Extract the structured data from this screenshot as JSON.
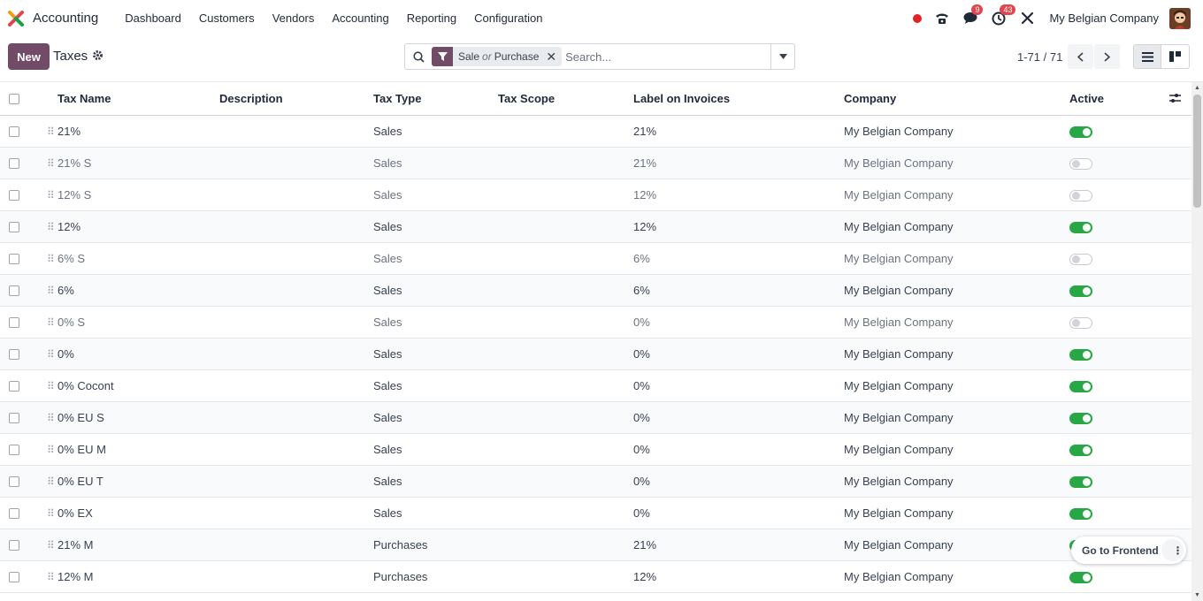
{
  "nav": {
    "app_name": "Accounting",
    "menu": [
      "Dashboard",
      "Customers",
      "Vendors",
      "Accounting",
      "Reporting",
      "Configuration"
    ],
    "messages_count": "9",
    "activities_count": "43",
    "company": "My Belgian Company"
  },
  "control": {
    "new_label": "New",
    "title": "Taxes",
    "facet_left": "Sale",
    "facet_or": "or",
    "facet_right": "Purchase",
    "search_placeholder": "Search...",
    "pager": "1-71 / 71"
  },
  "columns": [
    "Tax Name",
    "Description",
    "Tax Type",
    "Tax Scope",
    "Label on Invoices",
    "Company",
    "Active"
  ],
  "rows": [
    {
      "name": "21%",
      "type": "Sales",
      "label": "21%",
      "company": "My Belgian Company",
      "active": true
    },
    {
      "name": "21% S",
      "type": "Sales",
      "label": "21%",
      "company": "My Belgian Company",
      "active": false
    },
    {
      "name": "12% S",
      "type": "Sales",
      "label": "12%",
      "company": "My Belgian Company",
      "active": false
    },
    {
      "name": "12%",
      "type": "Sales",
      "label": "12%",
      "company": "My Belgian Company",
      "active": true
    },
    {
      "name": "6% S",
      "type": "Sales",
      "label": "6%",
      "company": "My Belgian Company",
      "active": false
    },
    {
      "name": "6%",
      "type": "Sales",
      "label": "6%",
      "company": "My Belgian Company",
      "active": true
    },
    {
      "name": "0% S",
      "type": "Sales",
      "label": "0%",
      "company": "My Belgian Company",
      "active": false
    },
    {
      "name": "0%",
      "type": "Sales",
      "label": "0%",
      "company": "My Belgian Company",
      "active": true
    },
    {
      "name": "0% Cocont",
      "type": "Sales",
      "label": "0%",
      "company": "My Belgian Company",
      "active": true
    },
    {
      "name": "0% EU S",
      "type": "Sales",
      "label": "0%",
      "company": "My Belgian Company",
      "active": true
    },
    {
      "name": "0% EU M",
      "type": "Sales",
      "label": "0%",
      "company": "My Belgian Company",
      "active": true
    },
    {
      "name": "0% EU T",
      "type": "Sales",
      "label": "0%",
      "company": "My Belgian Company",
      "active": true
    },
    {
      "name": "0% EX",
      "type": "Sales",
      "label": "0%",
      "company": "My Belgian Company",
      "active": true
    },
    {
      "name": "21% M",
      "type": "Purchases",
      "label": "21%",
      "company": "My Belgian Company",
      "active": true
    },
    {
      "name": "12% M",
      "type": "Purchases",
      "label": "12%",
      "company": "My Belgian Company",
      "active": true
    }
  ],
  "floating": {
    "frontend_label": "Go to Frontend"
  },
  "colors": {
    "brand": "#714b67",
    "toggle_on": "#28a745"
  }
}
